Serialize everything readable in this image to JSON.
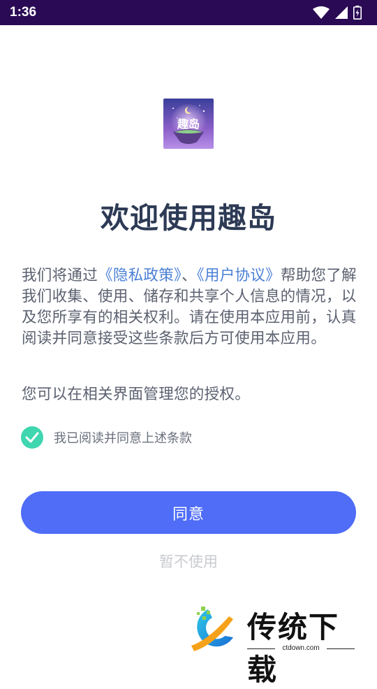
{
  "status_bar": {
    "time": "1:36",
    "icons": [
      "wifi-icon",
      "cellular-signal-icon",
      "battery-charging-icon"
    ],
    "background_color": "#2a0a55"
  },
  "app": {
    "icon_name": "quidao-app-icon",
    "icon_text": "趣岛"
  },
  "welcome_title": "欢迎使用趣岛",
  "intro": {
    "before": "我们将通过",
    "privacy_link": "《隐私政策》",
    "separator": "、",
    "user_agreement_link": "《用户协议》",
    "after": "帮助您了解我们收集、使用、储存和共享个人信息的情况，以及您所享有的相关权利。请在使用本应用前，认真阅读并同意接受这些条款后方可使用本应用。"
  },
  "manage_text": "您可以在相关界面管理您的授权。",
  "agree_checkbox": {
    "checked": true,
    "label": "我已阅读并同意上述条款",
    "color": "#3fd6b0"
  },
  "buttons": {
    "agree": "同意",
    "decline": "暂不使用",
    "accent_color": "#4f6df7"
  },
  "watermark": {
    "name": "传统下载",
    "url": "ctdown.com"
  }
}
